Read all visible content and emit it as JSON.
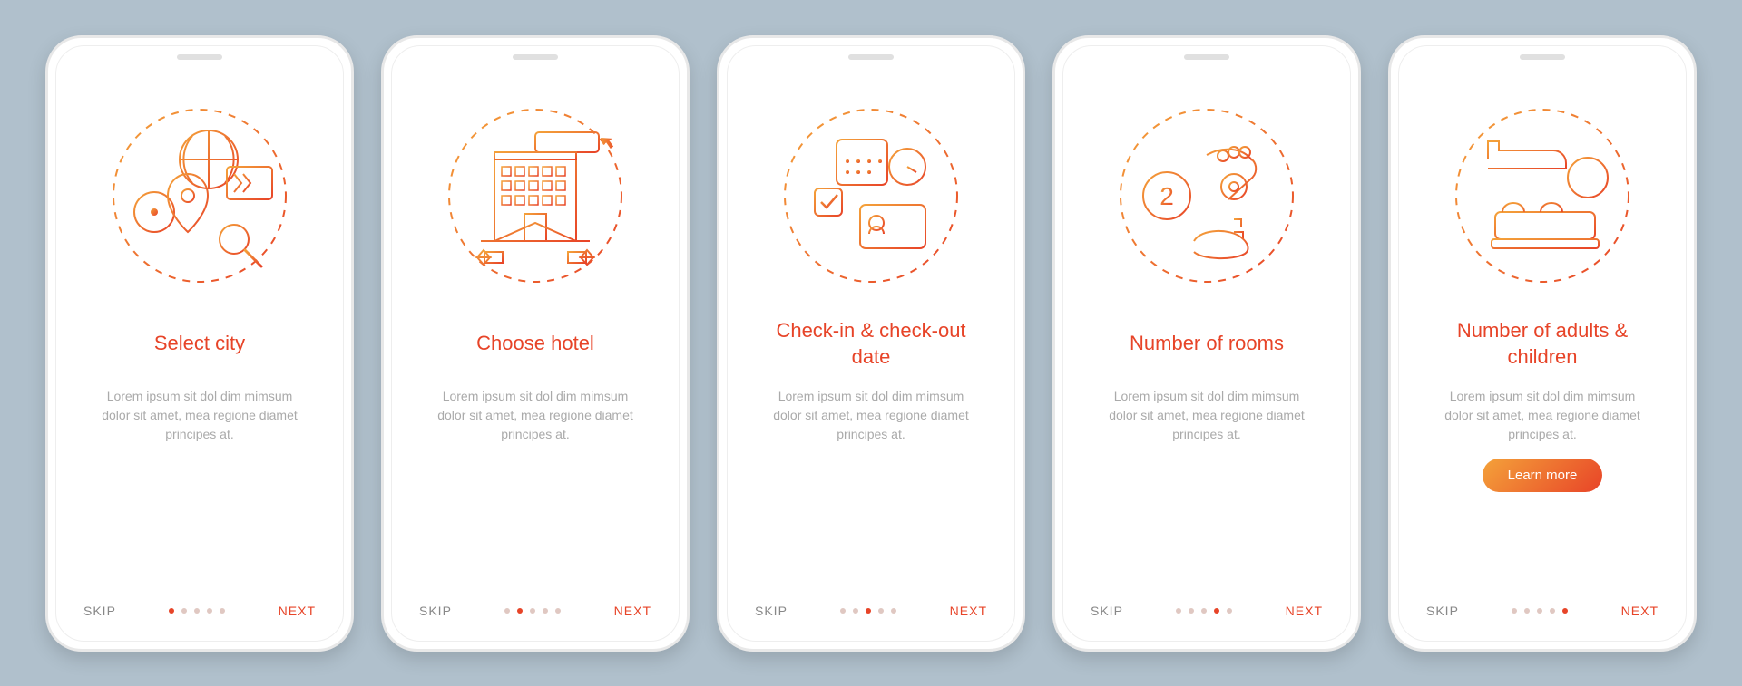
{
  "colors": {
    "accent_start": "#f4a23a",
    "accent_end": "#e84428",
    "text_muted": "#aaaaaa",
    "skip": "#888888"
  },
  "common": {
    "skip": "SKIP",
    "next": "NEXT",
    "placeholder_body": "Lorem ipsum sit dol dim mimsum dolor sit amet, mea regione diamet principes at.",
    "learn_more": "Learn more"
  },
  "screens": [
    {
      "id": "select-city",
      "title": "Select city",
      "icon": "city-select-icon",
      "active_dot": 0,
      "has_cta": false
    },
    {
      "id": "choose-hotel",
      "title": "Choose hotel",
      "icon": "hotel-icon",
      "active_dot": 1,
      "has_cta": false
    },
    {
      "id": "check-dates",
      "title": "Check-in & check-out date",
      "icon": "calendar-icon",
      "active_dot": 2,
      "has_cta": false
    },
    {
      "id": "number-rooms",
      "title": "Number of rooms",
      "icon": "rooms-icon",
      "active_dot": 3,
      "has_cta": false
    },
    {
      "id": "number-people",
      "title": "Number of adults & children",
      "icon": "people-icon",
      "active_dot": 4,
      "has_cta": true
    }
  ]
}
